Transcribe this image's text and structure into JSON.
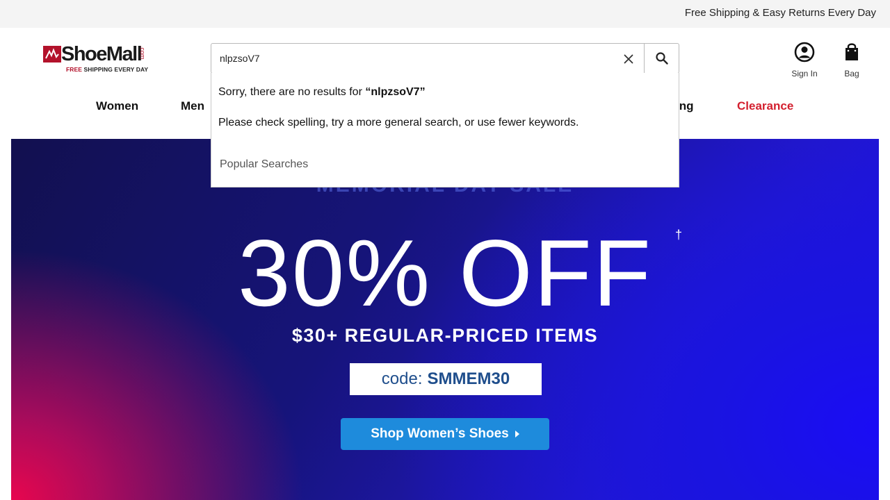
{
  "topbar": {
    "text": "Free Shipping & Easy Returns Every Day"
  },
  "logo": {
    "word": "ShoeMall",
    "com": ".com",
    "tag_red": "FREE",
    "tag_rest": " SHIPPING EVERY DAY",
    "brand_red": "#b3122b"
  },
  "search": {
    "value": "nlpzsoV7",
    "clear_icon": "close-icon",
    "search_icon": "search-icon"
  },
  "account": {
    "signin_label": "Sign In",
    "bag_label": "Bag"
  },
  "nav": {
    "women": "Women",
    "men": "Men",
    "partial": "ing",
    "clearance": "Clearance",
    "clearance_color": "#d3202f"
  },
  "dropdown": {
    "no_results_prefix": "Sorry, there are no results for ",
    "query_quoted": "“nlpzsoV7”",
    "suggestion": "Please check spelling, try a more general search, or use fewer keywords.",
    "popular_heading": "Popular Searches"
  },
  "hero": {
    "ghost_text": "MEMORIAL DAY SALE",
    "headline": "30% OFF",
    "dagger": "†",
    "subline": "$30+ REGULAR-PRICED ITEMS",
    "code_label": "code:",
    "code_value": "SMMEM30",
    "cta": "Shop Women’s Shoes"
  }
}
